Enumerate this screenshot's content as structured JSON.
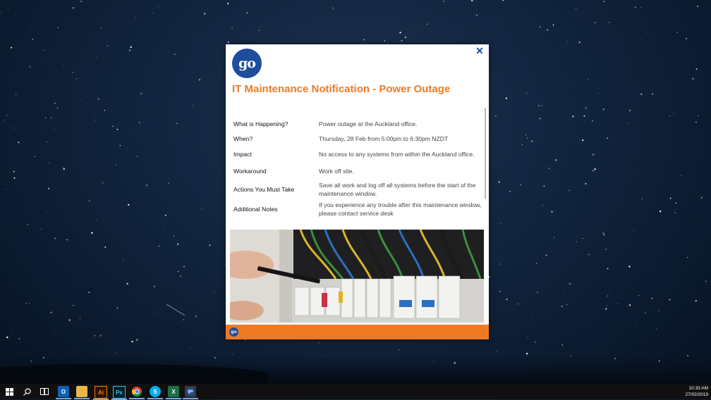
{
  "popup": {
    "logo_text": "go",
    "title": "IT Maintenance Notification - Power Outage",
    "close_icon": "close-icon",
    "rows": [
      {
        "label": "What is Happening?",
        "value": "Power outage at the Auckland office."
      },
      {
        "label": "When?",
        "value": "Thursday, 28 Feb from 5:00pm to 6:30pm NZDT"
      },
      {
        "label": "Impact",
        "value": "No access to any systems from within the Auckland office."
      },
      {
        "label": "Workaround",
        "value": "Work off site."
      },
      {
        "label": "Actions You Must Take",
        "value": "Save all work and log off all systems before the start of the maintenance window."
      },
      {
        "label": "Additional Notes",
        "value": "If you experience any trouble after this maintenance window, please contact service desk"
      }
    ],
    "footer_logo_text": "go"
  },
  "taskbar": {
    "icons": [
      {
        "name": "windows-start-icon",
        "text": ""
      },
      {
        "name": "search-icon",
        "text": ""
      },
      {
        "name": "task-view-icon",
        "text": ""
      },
      {
        "name": "outlook-icon",
        "text": "O"
      },
      {
        "name": "file-explorer-icon",
        "text": ""
      },
      {
        "name": "illustrator-icon",
        "text": "Ai"
      },
      {
        "name": "photoshop-icon",
        "text": "Ps"
      },
      {
        "name": "chrome-icon",
        "text": ""
      },
      {
        "name": "skype-icon",
        "text": "S"
      },
      {
        "name": "excel-icon",
        "text": "X"
      },
      {
        "name": "go-app-icon",
        "text": "go"
      }
    ],
    "time": "10:33 AM",
    "date": "27/02/2019"
  },
  "colors": {
    "accent_orange": "#ef7a22",
    "brand_blue": "#1e4d9e"
  }
}
